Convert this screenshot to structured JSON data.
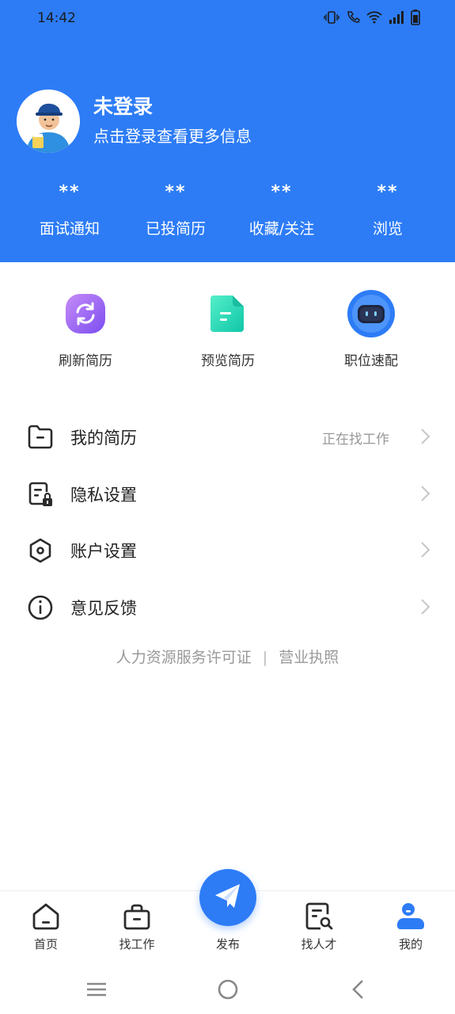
{
  "status_bar": {
    "time": "14:42"
  },
  "profile": {
    "title": "未登录",
    "subtitle": "点击登录查看更多信息"
  },
  "stats": [
    {
      "value": "**",
      "label": "面试通知"
    },
    {
      "value": "**",
      "label": "已投简历"
    },
    {
      "value": "**",
      "label": "收藏/关注"
    },
    {
      "value": "**",
      "label": "浏览"
    }
  ],
  "quick_actions": [
    {
      "label": "刷新简历",
      "icon": "refresh-icon"
    },
    {
      "label": "预览简历",
      "icon": "document-icon"
    },
    {
      "label": "职位速配",
      "icon": "robot-icon"
    }
  ],
  "menu": [
    {
      "label": "我的简历",
      "status": "正在找工作",
      "icon": "folder-icon"
    },
    {
      "label": "隐私设置",
      "status": "",
      "icon": "lock-document-icon"
    },
    {
      "label": "账户设置",
      "status": "",
      "icon": "hexagon-settings-icon"
    },
    {
      "label": "意见反馈",
      "status": "",
      "icon": "info-icon"
    }
  ],
  "footer": {
    "license": "人力资源服务许可证",
    "separator": "|",
    "business_license": "营业执照"
  },
  "bottom_nav": {
    "items": [
      {
        "label": "首页",
        "icon": "home-icon"
      },
      {
        "label": "找工作",
        "icon": "briefcase-icon"
      },
      {
        "label": "发布",
        "icon": "paper-plane-icon"
      },
      {
        "label": "找人才",
        "icon": "search-document-icon"
      },
      {
        "label": "我的",
        "icon": "user-icon"
      }
    ],
    "active_index": 4
  },
  "colors": {
    "primary": "#2d7cf6",
    "text_secondary": "#999999"
  }
}
